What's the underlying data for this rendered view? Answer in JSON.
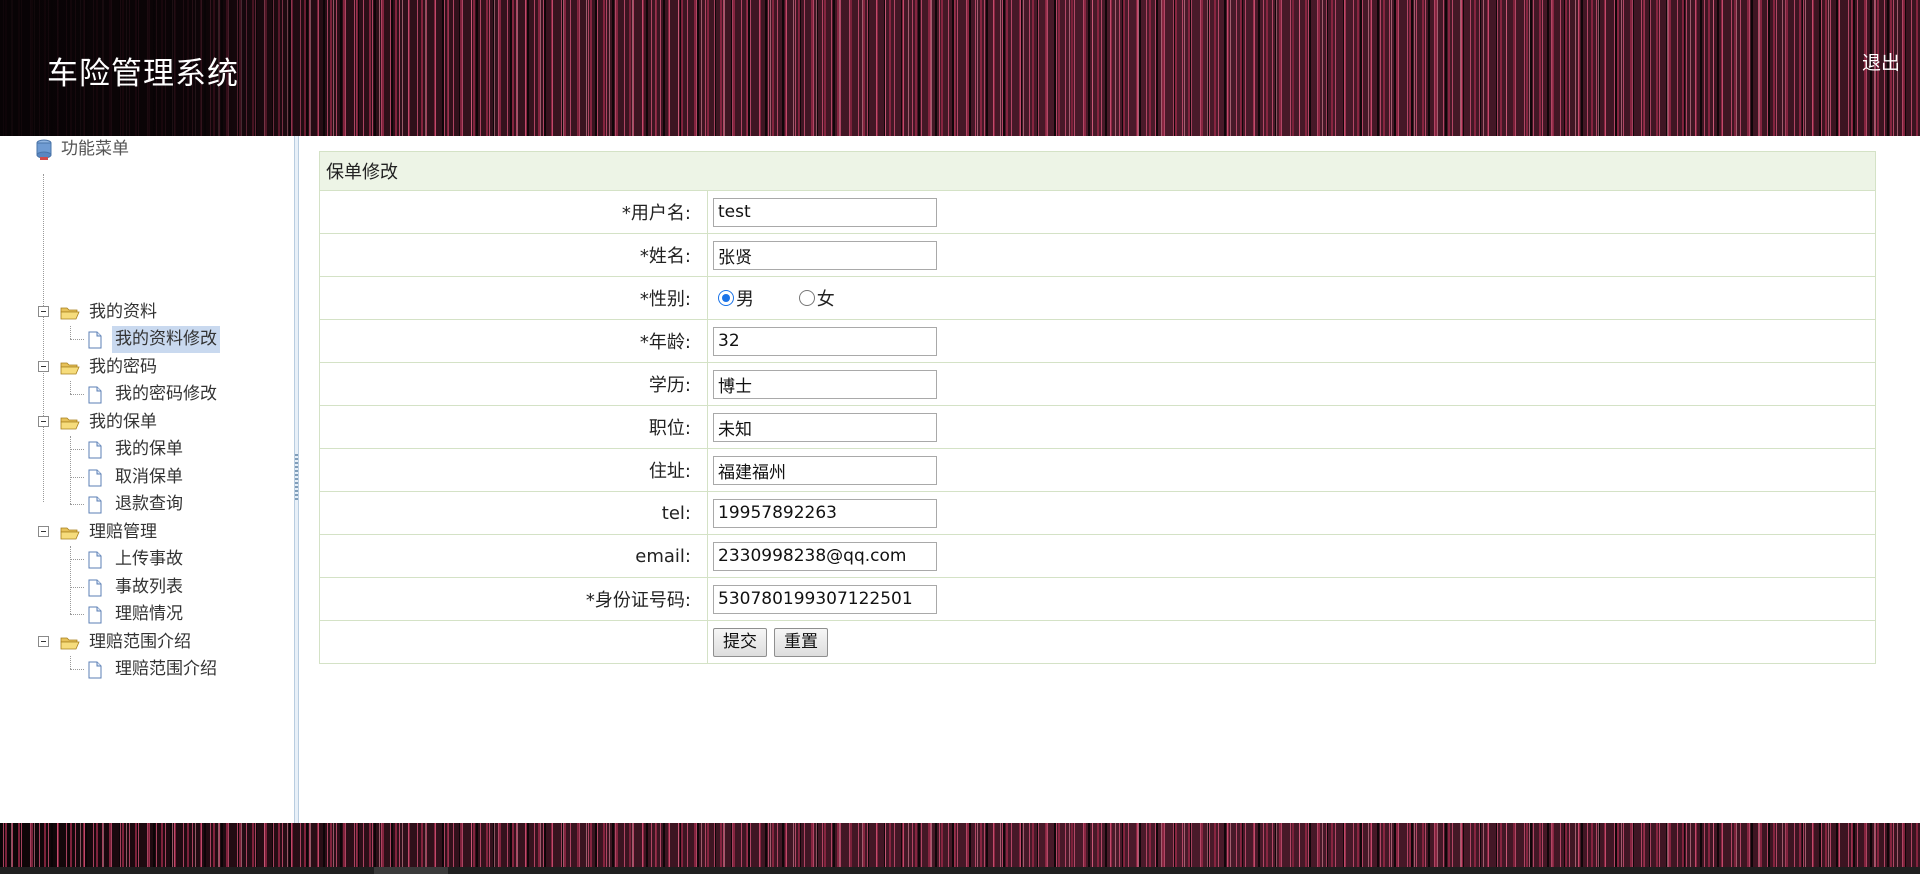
{
  "header": {
    "title": "车险管理系统",
    "logout_label": "退出"
  },
  "sidebar": {
    "root_label": "功能菜单",
    "groups": [
      {
        "label": "我的资料",
        "items": [
          {
            "label": "我的资料修改",
            "selected": true
          }
        ]
      },
      {
        "label": "我的密码",
        "items": [
          {
            "label": "我的密码修改"
          }
        ]
      },
      {
        "label": "我的保单",
        "items": [
          {
            "label": "我的保单"
          },
          {
            "label": "取消保单"
          },
          {
            "label": "退款查询"
          }
        ]
      },
      {
        "label": "理赔管理",
        "items": [
          {
            "label": "上传事故"
          },
          {
            "label": "事故列表"
          },
          {
            "label": "理赔情况"
          }
        ]
      },
      {
        "label": "理赔范围介绍",
        "items": [
          {
            "label": "理赔范围介绍"
          }
        ]
      }
    ]
  },
  "form": {
    "caption": "保单修改",
    "fields": {
      "username": {
        "label": "*用户名:",
        "value": "test"
      },
      "name": {
        "label": "*姓名:",
        "value": "张贤"
      },
      "gender": {
        "label": "*性别:",
        "options": [
          "男",
          "女"
        ],
        "selected": "男"
      },
      "age": {
        "label": "*年龄:",
        "value": "32"
      },
      "education": {
        "label": "学历:",
        "value": "博士"
      },
      "position": {
        "label": "职位:",
        "value": "未知"
      },
      "address": {
        "label": "住址:",
        "value": "福建福州"
      },
      "tel": {
        "label": "tel:",
        "value": "19957892263"
      },
      "email": {
        "label": "email:",
        "value": "2330998238@qq.com"
      },
      "idcard": {
        "label": "*身份证号码:",
        "value": "530780199307122501"
      }
    },
    "submit_label": "提交",
    "reset_label": "重置"
  },
  "colors": {
    "header_stripe_accent": "#d6567a",
    "header_dark": "#2a0f17",
    "form_caption_bg": "#edf4e6",
    "form_border": "#d4e2c6",
    "tree_selected_bg": "#c9d9ef",
    "radio_accent": "#1a73e8"
  },
  "icons": {
    "root": "database-icon",
    "group": "folder-open-icon",
    "item": "page-icon",
    "expander": "collapse-minus-icon"
  }
}
